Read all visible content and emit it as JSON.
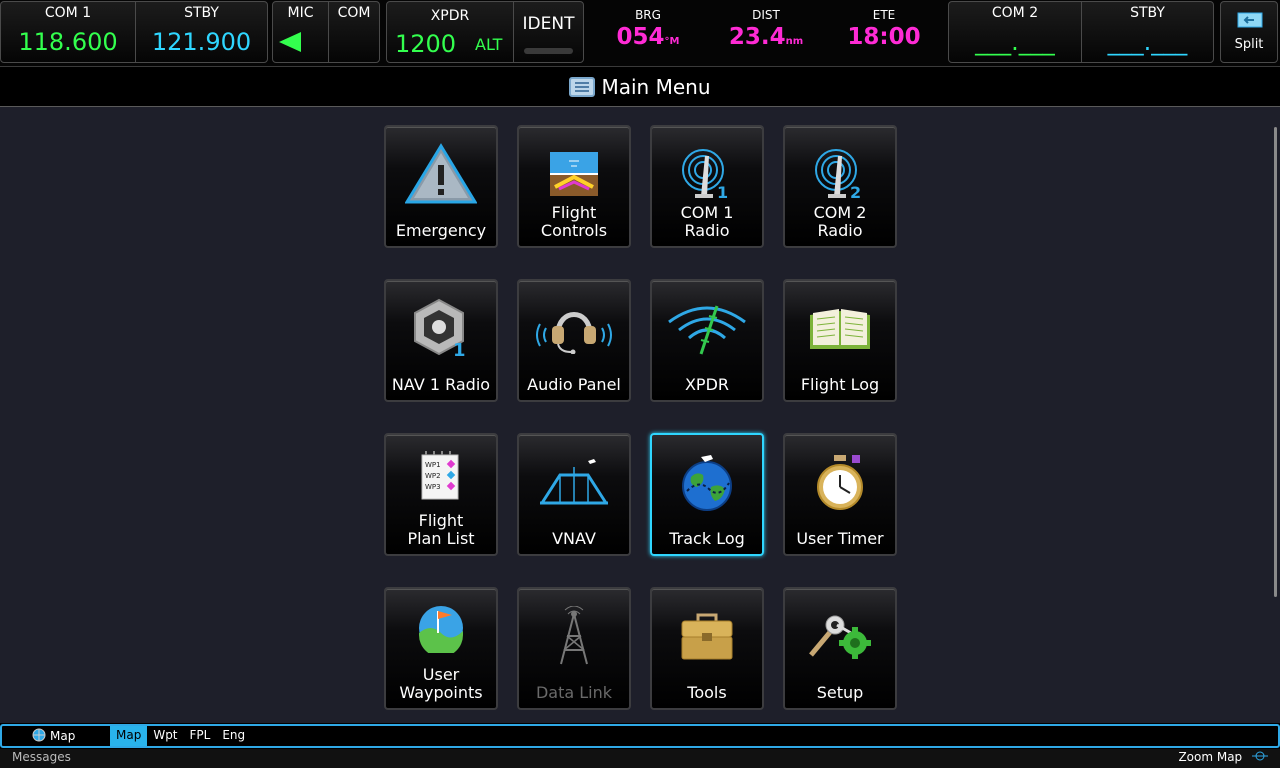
{
  "topbar": {
    "com1": {
      "label": "COM 1",
      "active": "118.600"
    },
    "com1_stby": {
      "label": "STBY",
      "value": "121.900"
    },
    "mic": {
      "label": "MIC"
    },
    "com": {
      "label": "COM"
    },
    "xpdr": {
      "label": "XPDR",
      "code": "1200",
      "mode": "ALT"
    },
    "ident": {
      "label": "IDENT"
    },
    "brg": {
      "label": "BRG",
      "value": "054",
      "unit": "°M"
    },
    "dist": {
      "label": "DIST",
      "value": "23.4",
      "unit": "nm"
    },
    "ete": {
      "label": "ETE",
      "value": "18:00"
    },
    "com2": {
      "label": "COM 2",
      "active": "___.___"
    },
    "com2_stby": {
      "label": "STBY",
      "value": "___.___"
    },
    "split": {
      "label": "Split"
    }
  },
  "title": "Main Menu",
  "tiles": [
    {
      "label": "Emergency",
      "icon": "warning-triangle-icon"
    },
    {
      "label": "Flight\nControls",
      "icon": "attitude-indicator-icon"
    },
    {
      "label": "COM 1\nRadio",
      "icon": "radio-1-icon"
    },
    {
      "label": "COM 2\nRadio",
      "icon": "radio-2-icon"
    },
    {
      "label": "NAV 1 Radio",
      "icon": "nav-radio-icon"
    },
    {
      "label": "Audio Panel",
      "icon": "headset-icon"
    },
    {
      "label": "XPDR",
      "icon": "transponder-icon"
    },
    {
      "label": "Flight Log",
      "icon": "logbook-icon"
    },
    {
      "label": "Flight\nPlan List",
      "icon": "flight-plan-list-icon"
    },
    {
      "label": "VNAV",
      "icon": "vnav-profile-icon"
    },
    {
      "label": "Track Log",
      "icon": "globe-track-icon"
    },
    {
      "label": "User Timer",
      "icon": "stopwatch-icon"
    },
    {
      "label": "User\nWaypoints",
      "icon": "waypoint-flag-icon"
    },
    {
      "label": "Data Link",
      "icon": "datalink-tower-icon"
    },
    {
      "label": "Tools",
      "icon": "toolbox-icon"
    },
    {
      "label": "Setup",
      "icon": "setup-gear-icon"
    }
  ],
  "bottom": {
    "pane_label": "Map",
    "tabs": [
      "Map",
      "Wpt",
      "FPL",
      "Eng"
    ],
    "messages": "Messages",
    "zoom": "Zoom Map"
  },
  "colors": {
    "active_freq": "#33ff4e",
    "standby_freq": "#2fd6ff",
    "nav_data": "#ff2bd5",
    "selection": "#2fd6ff"
  }
}
